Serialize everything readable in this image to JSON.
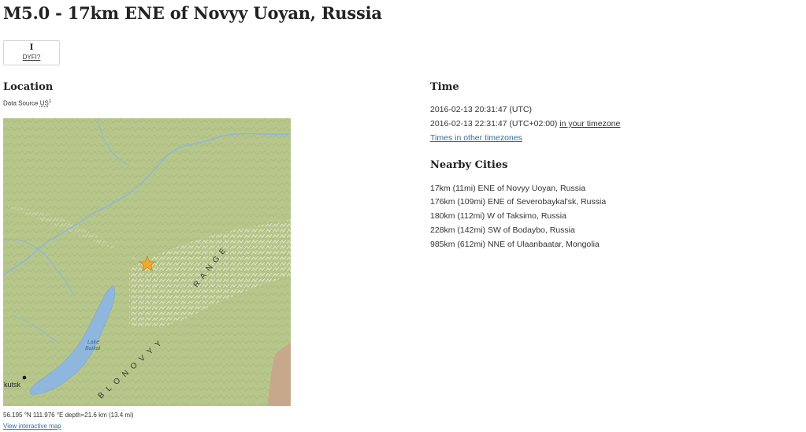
{
  "page": {
    "title": "M5.0 - 17km ENE of Novyy Uoyan, Russia"
  },
  "dyfi": {
    "value": "I",
    "label": "DYFI?"
  },
  "location": {
    "heading": "Location",
    "data_source_label": "Data Source",
    "data_source_link": "US",
    "data_source_sup": "1",
    "coordinates": "56.195 °N 111.976 °E depth=21.6 km (13.4 mi)",
    "view_map_link": "View interactive map",
    "map_labels": {
      "lake": "Lake",
      "lake2": "Baikal",
      "city": "kutsk",
      "range_upper": "RANGE",
      "range_lower": "BLONOVYY"
    },
    "marker_color": "#f3a82b"
  },
  "time": {
    "heading": "Time",
    "utc": "2016-02-13 20:31:47 (UTC)",
    "local": "2016-02-13 22:31:47 (UTC+02:00)",
    "local_link": "in your timezone",
    "other_link": "Times in other timezones"
  },
  "nearby": {
    "heading": "Nearby Cities",
    "cities": [
      "17km (11mi) ENE of Novyy Uoyan, Russia",
      "176km (109mi) ENE of Severobaykal'sk, Russia",
      "180km (112mi) W of Taksimo, Russia",
      "228km (142mi) SW of Bodaybo, Russia",
      "985km (612mi) NNE of Ulaanbaatar, Mongolia"
    ]
  },
  "colors": {
    "link": "#2e6f9e",
    "map_terrain": "#b9c98c",
    "water": "#8fb6dc"
  }
}
